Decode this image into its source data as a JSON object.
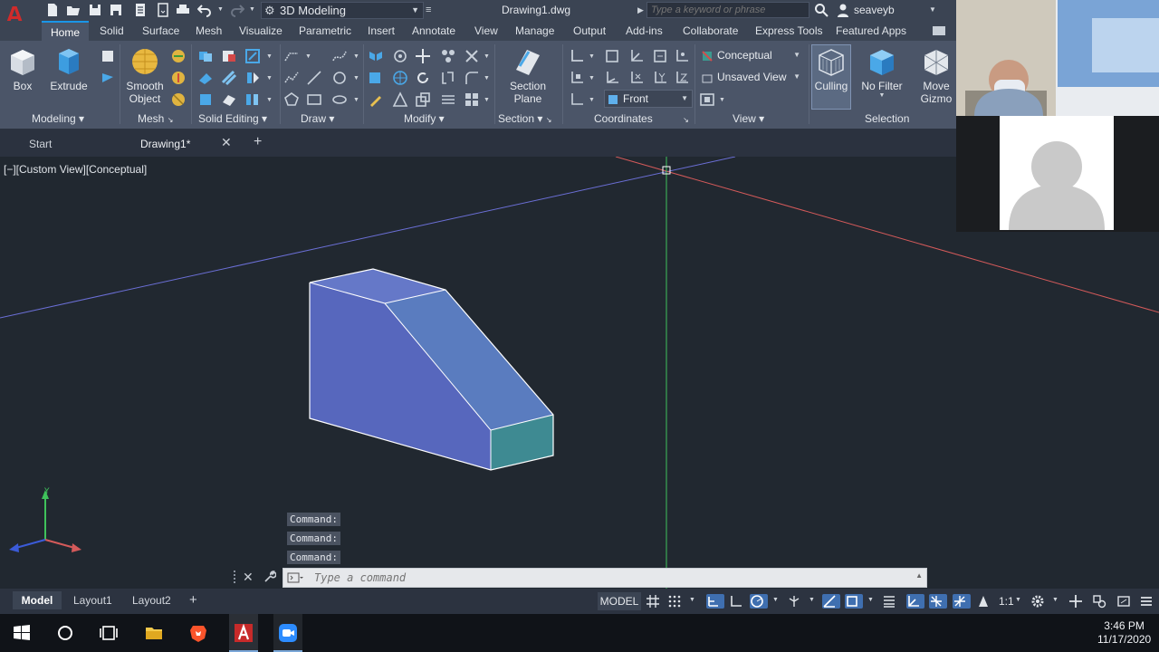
{
  "app": {
    "logo_letter": "A",
    "workspace": "3D Modeling",
    "document_title": "Drawing1.dwg",
    "search_placeholder": "Type a keyword or phrase",
    "user_name": "seaveyb"
  },
  "ribbon_tabs": [
    "Home",
    "Solid",
    "Surface",
    "Mesh",
    "Visualize",
    "Parametric",
    "Insert",
    "Annotate",
    "View",
    "Manage",
    "Output",
    "Add-ins",
    "Collaborate",
    "Express Tools",
    "Featured Apps"
  ],
  "ribbon": {
    "box_label": "Box",
    "extrude_label": "Extrude",
    "smooth_object_label_1": "Smooth",
    "smooth_object_label_2": "Object",
    "section_plane_label_1": "Section",
    "section_plane_label_2": "Plane",
    "visual_style": "Conceptual",
    "named_view": "Unsaved View",
    "view_direction": "Front",
    "culling_label": "Culling",
    "no_filter_label": "No Filter",
    "move_gizmo_label_1": "Move",
    "move_gizmo_label_2": "Gizmo",
    "panels": {
      "modeling": "Modeling",
      "mesh": "Mesh",
      "solid_editing": "Solid Editing",
      "draw": "Draw",
      "modify": "Modify",
      "section": "Section",
      "coordinates": "Coordinates",
      "view": "View",
      "selection": "Selection"
    }
  },
  "file_tabs": {
    "start": "Start",
    "drawing": "Drawing1*"
  },
  "viewport": {
    "label": "[−][Custom View][Conceptual]",
    "command_history": [
      "Command:",
      "Command:",
      "Command:"
    ],
    "command_placeholder": "Type a command"
  },
  "layout_tabs": [
    "Model",
    "Layout1",
    "Layout2"
  ],
  "status": {
    "model_button": "MODEL",
    "annotation_scale": "1:1"
  },
  "taskbar": {
    "time": "3:46 PM",
    "date": "11/17/2020"
  },
  "colors": {
    "accent_blue": "#1a96e8",
    "solid_face_front": "#5767bd",
    "solid_face_top": "#6578c8",
    "solid_face_slope": "#5a7cbf",
    "solid_face_end": "#3e8a92",
    "axis_x": "#d45a5a",
    "axis_y": "#3fc25b",
    "axis_z": "#3b5bd8"
  }
}
